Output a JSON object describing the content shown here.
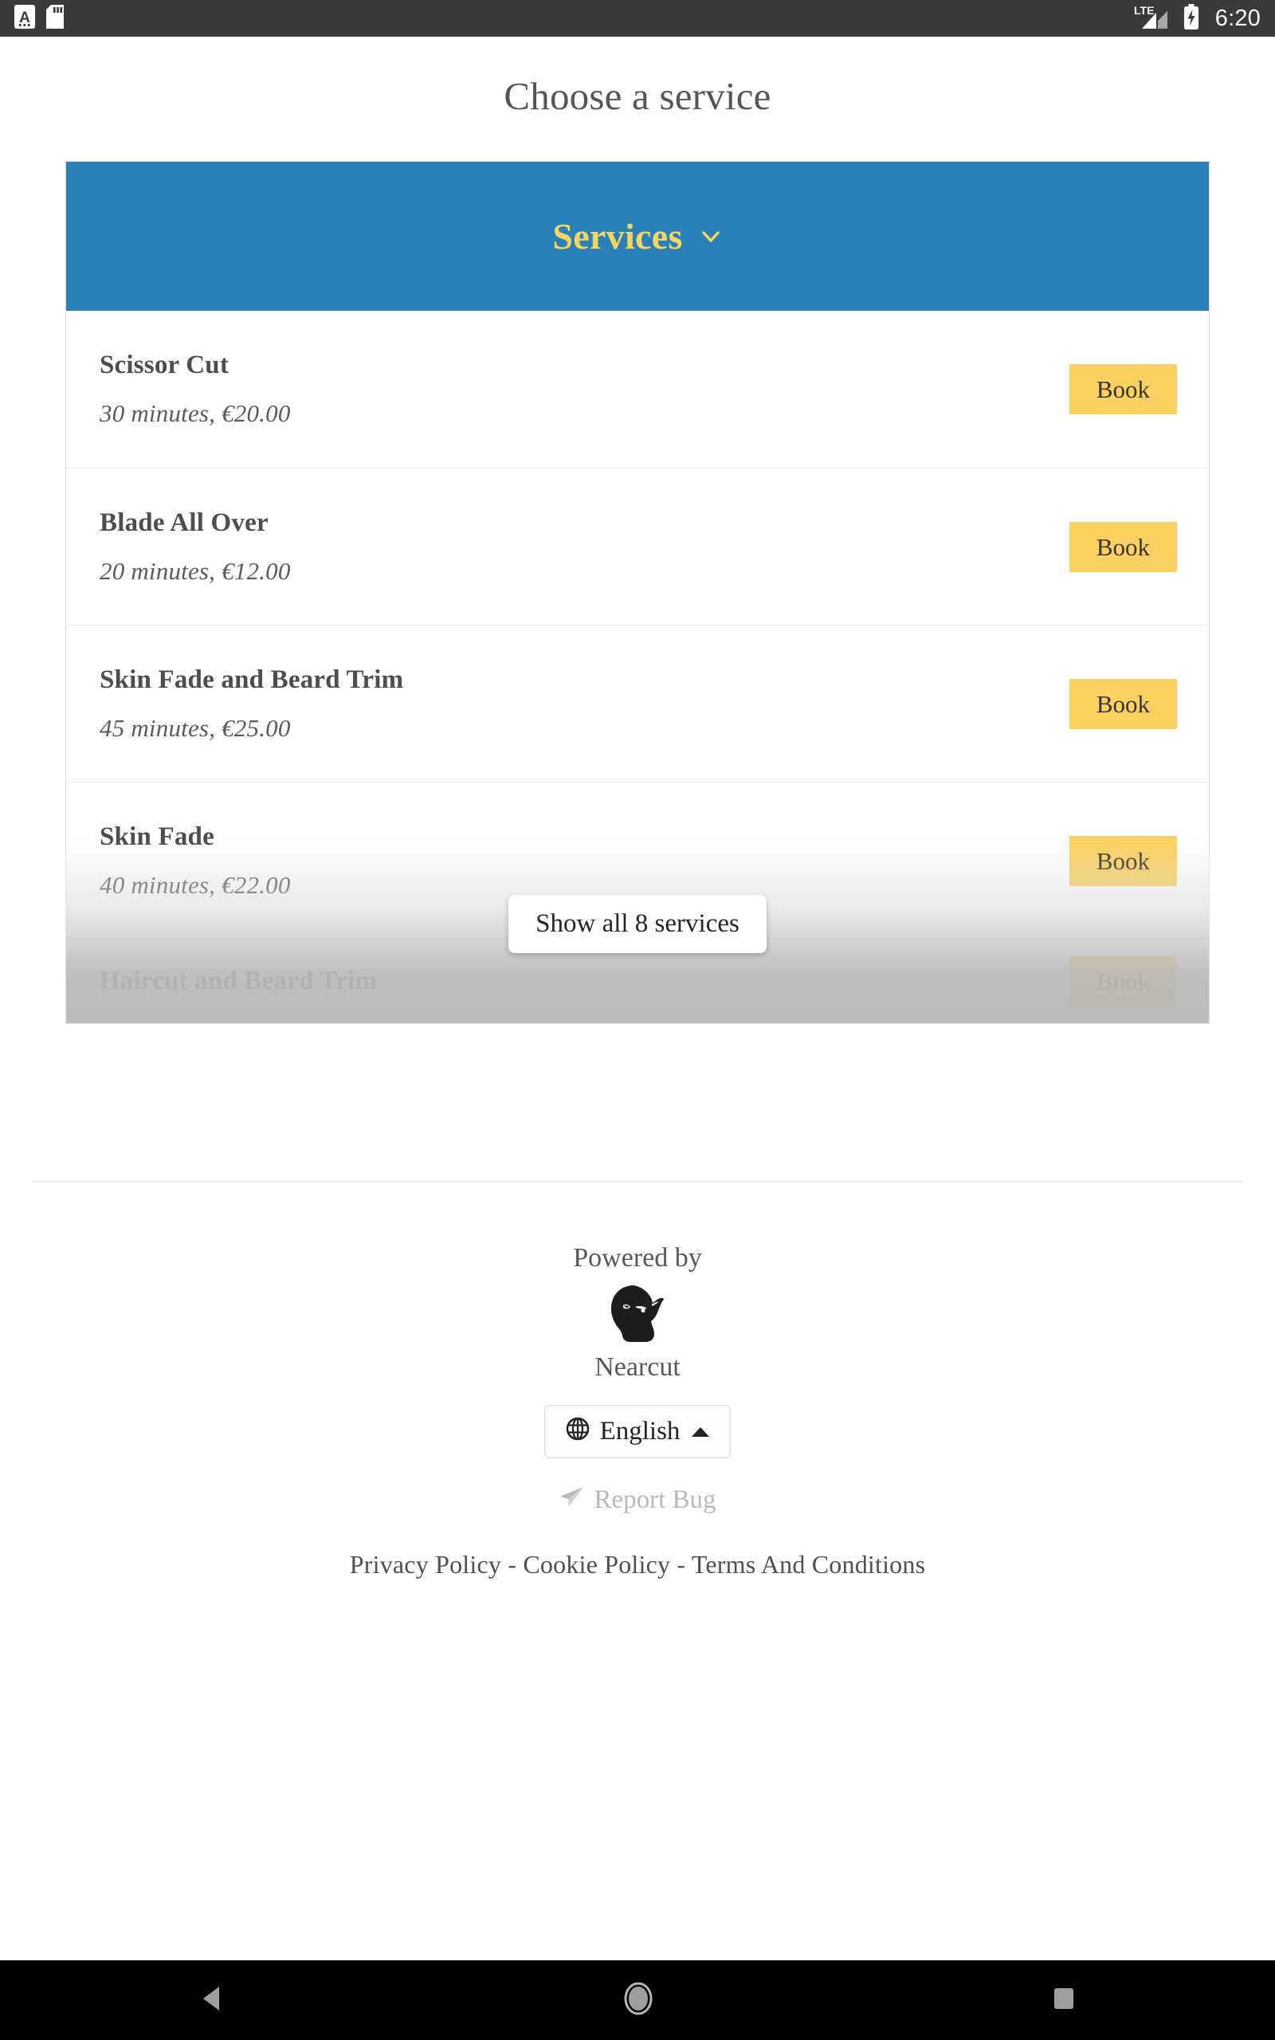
{
  "status_bar": {
    "time": "6:20",
    "left_icons": [
      "font-size-a-icon",
      "sd-card-icon"
    ],
    "right_icons": [
      "lte-signal-icon",
      "battery-charging-icon"
    ],
    "network_label": "LTE",
    "background": "#3a3a3a"
  },
  "page": {
    "title": "Choose a service"
  },
  "services_card": {
    "header_label": "Services",
    "header_color": "#2a80b9",
    "header_text_color": "#f6d560",
    "chevron_icon": "chevron-down-icon",
    "book_label": "Book",
    "book_color": "#fad161",
    "show_all_label": "Show all 8 services",
    "items": [
      {
        "name": "Scissor Cut",
        "meta": "30 minutes, €20.00",
        "book": "Book"
      },
      {
        "name": "Blade All Over",
        "meta": "20 minutes, €12.00",
        "book": "Book"
      },
      {
        "name": "Skin Fade and Beard Trim",
        "meta": "45 minutes, €25.00",
        "book": "Book"
      },
      {
        "name": "Skin Fade",
        "meta": "40 minutes, €22.00",
        "book": "Book"
      },
      {
        "name": "Haircut and Beard Trim",
        "meta": "",
        "book": "Book"
      }
    ]
  },
  "footer": {
    "powered_by": "Powered by",
    "brand": "Nearcut",
    "brand_logo_icon": "bearded-man-logo-icon",
    "language": {
      "label": "English",
      "globe_icon": "globe-icon",
      "caret_icon": "caret-up-icon"
    },
    "report_bug": {
      "label": "Report Bug",
      "icon": "paper-plane-icon"
    },
    "legal": {
      "privacy": "Privacy Policy",
      "separator_1": "-",
      "cookie": "Cookie Policy",
      "separator_2": "-",
      "terms": "Terms And Conditions"
    }
  },
  "nav_bar": {
    "back": "back-triangle-icon",
    "home": "home-circle-icon",
    "recents": "recents-square-icon"
  }
}
